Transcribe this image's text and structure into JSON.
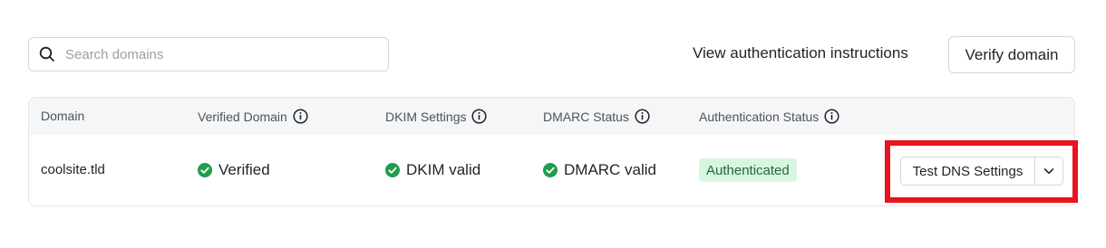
{
  "search": {
    "placeholder": "Search domains",
    "value": ""
  },
  "actions": {
    "instructions_link": "View authentication instructions",
    "verify_button": "Verify domain"
  },
  "table": {
    "columns": [
      {
        "label": "Domain",
        "has_info": false
      },
      {
        "label": "Verified Domain",
        "has_info": true
      },
      {
        "label": "DKIM Settings",
        "has_info": true
      },
      {
        "label": "DMARC Status",
        "has_info": true
      },
      {
        "label": "Authentication Status",
        "has_info": true
      }
    ],
    "rows": [
      {
        "domain": "coolsite.tld",
        "verified": "Verified",
        "dkim": "DKIM valid",
        "dmarc": "DMARC valid",
        "auth_status": "Authenticated",
        "action_label": "Test DNS Settings"
      }
    ]
  },
  "icons": {
    "search": "search-icon",
    "info": "info-icon",
    "check": "check-circle-icon",
    "chevron": "chevron-down-icon"
  },
  "colors": {
    "success": "#1f9d4c",
    "badge_bg": "#d8f5df",
    "badge_text": "#1e6b37",
    "highlight": "#e8141e"
  }
}
